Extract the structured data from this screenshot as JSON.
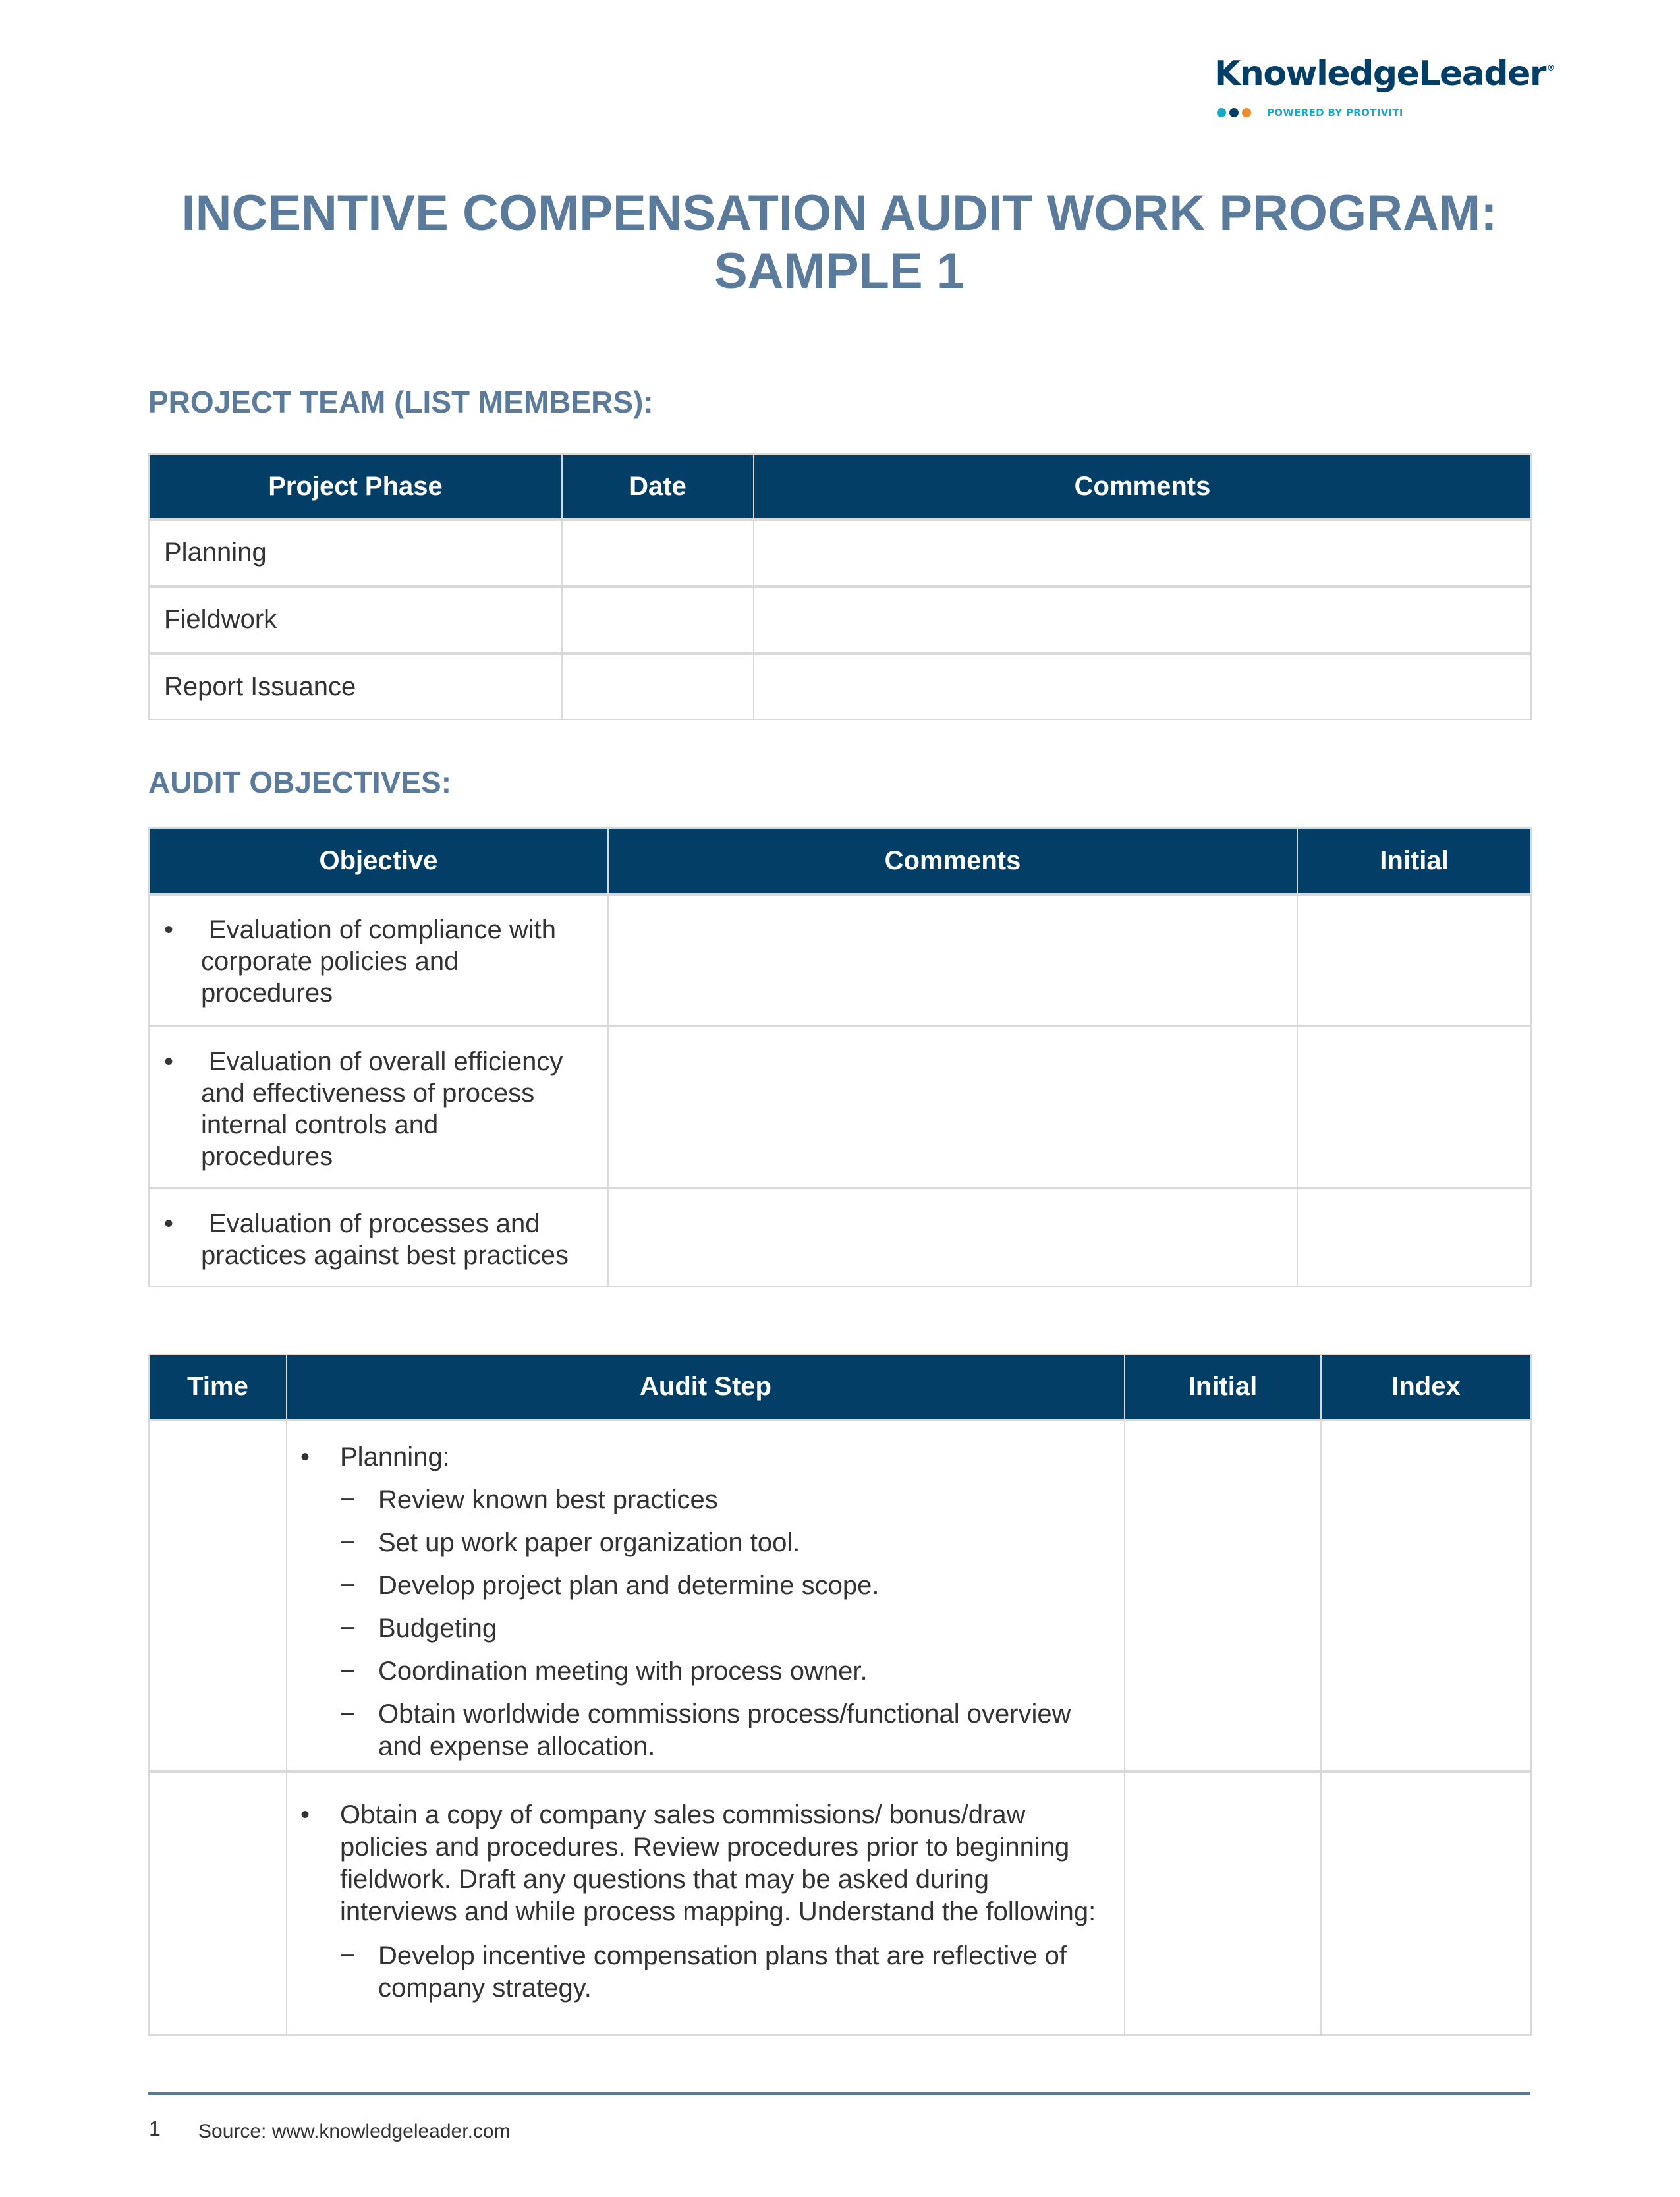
{
  "logo": {
    "wordmark": "KnowledgeLeader",
    "registered": "®",
    "tagline": "POWERED BY PROTIVITI",
    "dot_colors": [
      "#1aa8c9",
      "#033e66",
      "#f28c28"
    ]
  },
  "title": {
    "line1": "INCENTIVE COMPENSATION AUDIT WORK PROGRAM:",
    "line2": "SAMPLE 1"
  },
  "project_team": {
    "heading": "PROJECT TEAM (LIST MEMBERS):",
    "columns": [
      "Project Phase",
      "Date",
      "Comments"
    ],
    "rows": [
      {
        "phase": "Planning",
        "date": "",
        "comments": ""
      },
      {
        "phase": "Fieldwork",
        "date": "",
        "comments": ""
      },
      {
        "phase": "Report Issuance",
        "date": "",
        "comments": ""
      }
    ]
  },
  "audit_objectives": {
    "heading": "AUDIT OBJECTIVES:",
    "columns": [
      "Objective",
      "Comments",
      "Initial"
    ],
    "bullet": "•",
    "rows": [
      {
        "lines": [
          "Evaluation of compliance with",
          "corporate policies and",
          "procedures"
        ],
        "comments": "",
        "initial": ""
      },
      {
        "lines": [
          "Evaluation of overall efficiency",
          "and effectiveness of process",
          "internal controls and",
          "procedures"
        ],
        "comments": "",
        "initial": ""
      },
      {
        "lines": [
          "Evaluation of processes and",
          "practices against best practices"
        ],
        "comments": "",
        "initial": ""
      }
    ]
  },
  "audit_steps": {
    "columns": [
      "Time",
      "Audit Step",
      "Initial",
      "Index"
    ],
    "bullet": "•",
    "dash": "−",
    "rows": [
      {
        "time": "",
        "step": "Planning:",
        "substeps": [
          "Review known best practices",
          "Set up work paper organization tool.",
          "Develop project plan and determine scope.",
          "Budgeting",
          "Coordination meeting with process owner.",
          "Obtain worldwide commissions process/functional overview and expense allocation."
        ],
        "initial": "",
        "index": ""
      },
      {
        "time": "",
        "step": "Obtain a copy of company sales commissions/ bonus/draw policies and procedures. Review procedures prior to beginning fieldwork. Draft any questions that may be asked during interviews and while process mapping. Understand the following:",
        "substeps": [
          "Develop incentive compensation plans that are reflective of company strategy."
        ],
        "initial": "",
        "index": ""
      }
    ]
  },
  "footer": {
    "page_number": "1",
    "source": "Source: www.knowledgeleader.com"
  }
}
